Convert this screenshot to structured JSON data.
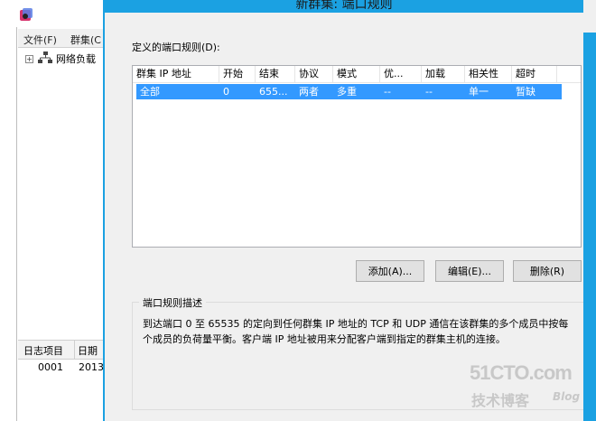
{
  "background_window": {
    "menu": [
      "文件(F)",
      "群集(C"
    ],
    "tree": {
      "expand": "+",
      "label": "网络负载"
    },
    "log": {
      "columns": [
        "日志项目",
        "日期"
      ],
      "rows": [
        [
          "0001",
          "2013"
        ]
      ]
    }
  },
  "dialog": {
    "title": "新群集: 端口规则",
    "rules_label": "定义的端口规则(D):",
    "columns": [
      "群集 IP 地址",
      "开始",
      "结束",
      "协议",
      "模式",
      "优...",
      "加载",
      "相关性",
      "超时"
    ],
    "rows": [
      [
        "全部",
        "0",
        "655...",
        "两者",
        "多重",
        "--",
        "--",
        "单一",
        "暂缺"
      ]
    ],
    "buttons": {
      "add": "添加(A)...",
      "edit": "编辑(E)...",
      "delete": "删除(R)"
    },
    "description": {
      "title": "端口规则描述",
      "text": "到达端口 0 至 65535 的定向到任何群集 IP 地址的 TCP 和 UDP 通信在该群集的多个成员中按每个成员的负荷量平衡。客户端 IP 地址被用来分配客户端到指定的群集主机的连接。"
    }
  },
  "watermark": {
    "main": "51CTO.com",
    "sub": "技术博客",
    "blog": "Blog"
  },
  "colors": {
    "accent": "#1ba1e2",
    "selection": "#3399ff",
    "dialog_bg": "#f0f0f0"
  }
}
